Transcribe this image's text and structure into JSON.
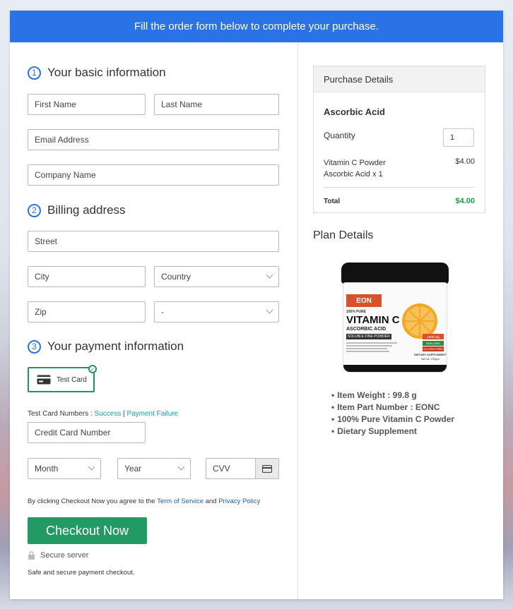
{
  "banner": "Fill the order form below to complete your purchase.",
  "sections": [
    {
      "num": "1",
      "title": "Your basic information"
    },
    {
      "num": "2",
      "title": "Billing address"
    },
    {
      "num": "3",
      "title": "Your payment information"
    }
  ],
  "fields": {
    "first_name": "First Name",
    "last_name": "Last Name",
    "email": "Email Address",
    "company": "Company Name",
    "street": "Street",
    "city": "City",
    "country": "Country",
    "zip": "Zip",
    "state": "-",
    "credit_card": "Credit Card Number",
    "month": "Month",
    "year": "Year",
    "cvv": "CVV"
  },
  "payment": {
    "test_card_label": "Test Card",
    "numbers_prefix": "Test Card Numbers : ",
    "success_link": "Success",
    "separator": " | ",
    "failure_link": "Payment Failure"
  },
  "agree": {
    "prefix": "By clicking Checkout Now you agree to the ",
    "terms": "Term of Service",
    "and": " and ",
    "privacy": "Privacy Policy"
  },
  "checkout_label": "Checkout Now",
  "secure_server": "Secure server",
  "secure_note": "Safe and secure payment checkout.",
  "purchase": {
    "header": "Purchase Details",
    "product": "Ascorbic Acid",
    "quantity_label": "Quantity",
    "quantity_value": "1",
    "item_line1": "Vitamin C Powder",
    "item_line2": "Ascorbic Acid x 1",
    "item_price": "$4.00",
    "total_label": "Total",
    "total_value": "$4.00"
  },
  "plan": {
    "title": "Plan Details",
    "jar": {
      "brand": "EON",
      "pure": "100% PURE",
      "name": "VITAMIN C",
      "sub": "ASCORBIC ACID",
      "powder": "SOLUBLE FINE POWDER",
      "mg": "1000 mg",
      "nongmo": "NON-GMO",
      "gluten": "GLUTEN FREE",
      "dietary": "DIETARY SUPPLEMENT",
      "netwt": "Net wt. 150gm"
    },
    "bullets": [
      "Item Weight : 99.8 g",
      "Item Part Number : EONC",
      "100% Pure Vitamin C Powder",
      "Dietary Supplement"
    ]
  },
  "colors": {
    "banner": "#2a73e6",
    "checkout": "#229a63",
    "total": "#1f9a4a",
    "link": "#1a9aa8"
  }
}
